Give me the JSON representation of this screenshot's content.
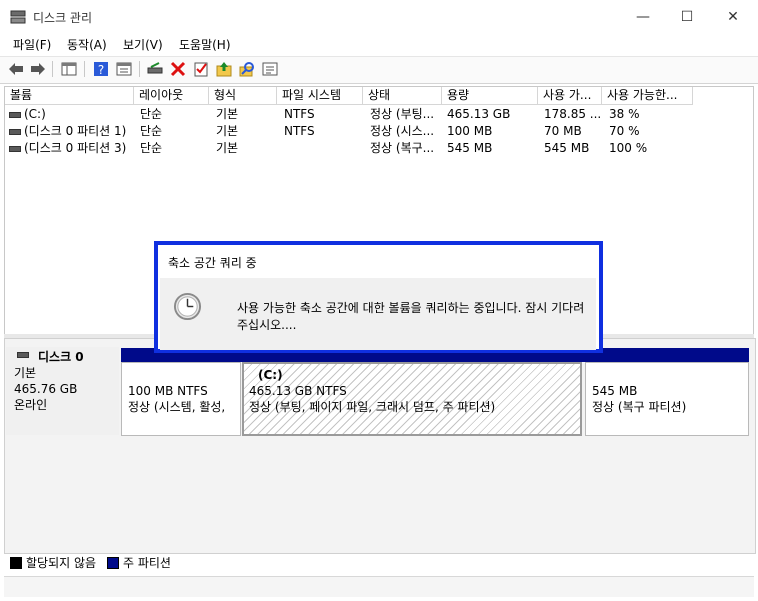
{
  "window": {
    "title": "디스크 관리",
    "minimize": "—",
    "maximize": "☐",
    "close": "✕"
  },
  "menu": [
    "파일(F)",
    "동작(A)",
    "보기(V)",
    "도움말(H)"
  ],
  "toolbar": {
    "icons": [
      "back-arrow-icon",
      "forward-arrow-icon",
      "console-tree-icon",
      "help-icon",
      "properties-icon",
      "connect-disk-icon",
      "delete-icon",
      "checklist-icon",
      "folder-up-icon",
      "search-icon",
      "settings-list-icon"
    ]
  },
  "columns": [
    "볼륨",
    "레이아웃",
    "형식",
    "파일 시스템",
    "상태",
    "용량",
    "사용 가...",
    "사용 가능한..."
  ],
  "volumes": [
    {
      "name": "(C:)",
      "layout": "단순",
      "type": "기본",
      "fs": "NTFS",
      "status": "정상 (부팅...",
      "capacity": "465.13 GB",
      "free": "178.85 ...",
      "pct": "38 %"
    },
    {
      "name": "(디스크 0 파티션 1)",
      "layout": "단순",
      "type": "기본",
      "fs": "NTFS",
      "status": "정상 (시스...",
      "capacity": "100 MB",
      "free": "70 MB",
      "pct": "70 %"
    },
    {
      "name": "(디스크 0 파티션 3)",
      "layout": "단순",
      "type": "기본",
      "fs": "",
      "status": "정상 (복구...",
      "capacity": "545 MB",
      "free": "545 MB",
      "pct": "100 %"
    }
  ],
  "dialog": {
    "title": "축소 공간 쿼리 중",
    "message": "사용 가능한 축소 공간에 대한 볼륨을 쿼리하는 중입니다. 잠시 기다려 주십시오...."
  },
  "disk": {
    "name": "디스크 0",
    "type": "기본",
    "size": "465.76 GB",
    "state": "온라인"
  },
  "partitions": [
    {
      "label": "",
      "size": "100 MB NTFS",
      "status": "정상 (시스템, 활성,"
    },
    {
      "label": "(C:)",
      "size": "465.13 GB NTFS",
      "status": "정상 (부팅, 페이지 파일, 크래시 덤프, 주 파티션)"
    },
    {
      "label": "",
      "size": "545 MB",
      "status": "정상 (복구 파티션)"
    }
  ],
  "legend": [
    {
      "label": "할당되지 않음",
      "color": "#000000"
    },
    {
      "label": "주 파티션",
      "color": "#000a8a"
    }
  ]
}
